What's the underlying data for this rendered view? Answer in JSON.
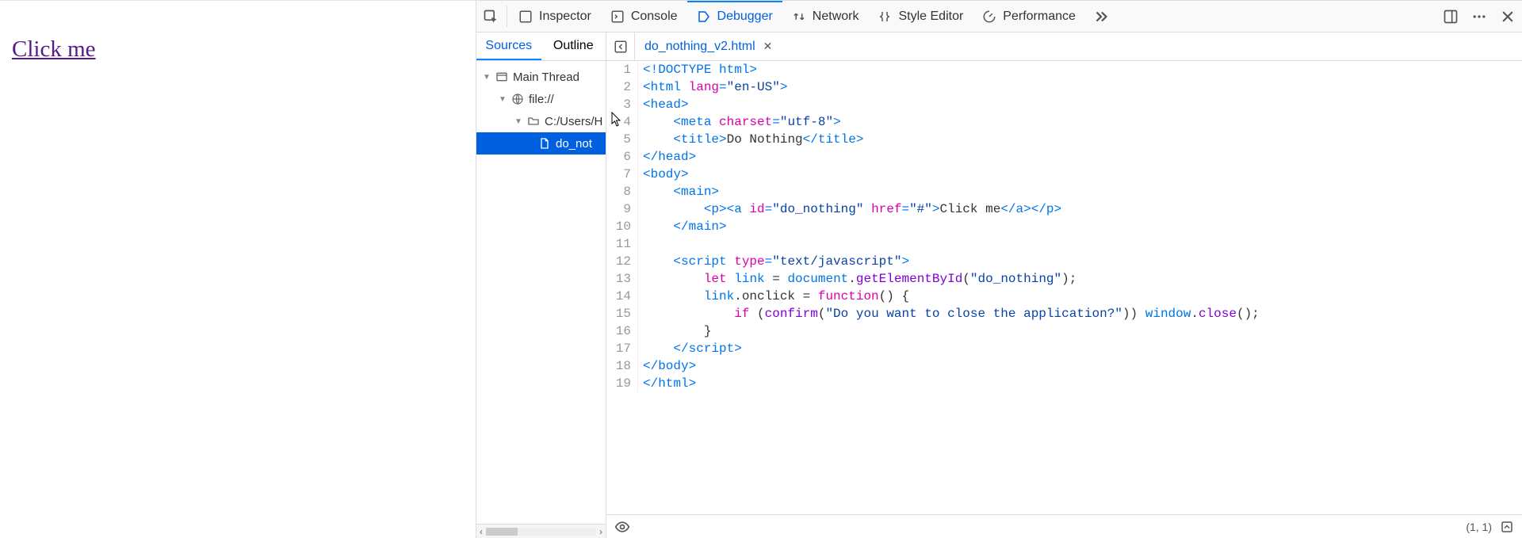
{
  "page": {
    "link_text": "Click me"
  },
  "devtools": {
    "tabs": {
      "inspector": "Inspector",
      "console": "Console",
      "debugger": "Debugger",
      "network": "Network",
      "style_editor": "Style Editor",
      "performance": "Performance"
    },
    "subtabs": {
      "sources": "Sources",
      "outline": "Outline"
    },
    "open_file": "do_nothing_v2.html",
    "tree": {
      "root": "Main Thread",
      "scheme": "file://",
      "folder": "C:/Users/H",
      "file": "do_not"
    },
    "cursor_pos": "(1, 1)",
    "code": {
      "lines": [
        [
          {
            "t": "doctype",
            "v": "<!DOCTYPE html>"
          }
        ],
        [
          {
            "t": "tag",
            "v": "<html "
          },
          {
            "t": "attr",
            "v": "lang"
          },
          {
            "t": "tag",
            "v": "="
          },
          {
            "t": "str",
            "v": "\"en-US\""
          },
          {
            "t": "tag",
            "v": ">"
          }
        ],
        [
          {
            "t": "tag",
            "v": "<head>"
          }
        ],
        [
          {
            "t": "text",
            "v": "    "
          },
          {
            "t": "tag",
            "v": "<meta "
          },
          {
            "t": "attr",
            "v": "charset"
          },
          {
            "t": "tag",
            "v": "="
          },
          {
            "t": "str",
            "v": "\"utf-8\""
          },
          {
            "t": "tag",
            "v": ">"
          }
        ],
        [
          {
            "t": "text",
            "v": "    "
          },
          {
            "t": "tag",
            "v": "<title>"
          },
          {
            "t": "text",
            "v": "Do Nothing"
          },
          {
            "t": "tag",
            "v": "</title>"
          }
        ],
        [
          {
            "t": "tag",
            "v": "</head>"
          }
        ],
        [
          {
            "t": "tag",
            "v": "<body>"
          }
        ],
        [
          {
            "t": "text",
            "v": "    "
          },
          {
            "t": "tag",
            "v": "<main>"
          }
        ],
        [
          {
            "t": "text",
            "v": "        "
          },
          {
            "t": "tag",
            "v": "<p><a "
          },
          {
            "t": "attr",
            "v": "id"
          },
          {
            "t": "tag",
            "v": "="
          },
          {
            "t": "str",
            "v": "\"do_nothing\""
          },
          {
            "t": "tag",
            "v": " "
          },
          {
            "t": "attr",
            "v": "href"
          },
          {
            "t": "tag",
            "v": "="
          },
          {
            "t": "str",
            "v": "\"#\""
          },
          {
            "t": "tag",
            "v": ">"
          },
          {
            "t": "text",
            "v": "Click me"
          },
          {
            "t": "tag",
            "v": "</a></p>"
          }
        ],
        [
          {
            "t": "text",
            "v": "    "
          },
          {
            "t": "tag",
            "v": "</main>"
          }
        ],
        [
          {
            "t": "text",
            "v": ""
          }
        ],
        [
          {
            "t": "text",
            "v": "    "
          },
          {
            "t": "tag",
            "v": "<script "
          },
          {
            "t": "attr",
            "v": "type"
          },
          {
            "t": "tag",
            "v": "="
          },
          {
            "t": "str",
            "v": "\"text/javascript\""
          },
          {
            "t": "tag",
            "v": ">"
          }
        ],
        [
          {
            "t": "text",
            "v": "        "
          },
          {
            "t": "kw",
            "v": "let"
          },
          {
            "t": "text",
            "v": " "
          },
          {
            "t": "var",
            "v": "link"
          },
          {
            "t": "text",
            "v": " = "
          },
          {
            "t": "var",
            "v": "document"
          },
          {
            "t": "text",
            "v": "."
          },
          {
            "t": "fn",
            "v": "getElementById"
          },
          {
            "t": "text",
            "v": "("
          },
          {
            "t": "str",
            "v": "\"do_nothing\""
          },
          {
            "t": "text",
            "v": ");"
          }
        ],
        [
          {
            "t": "text",
            "v": "        "
          },
          {
            "t": "var",
            "v": "link"
          },
          {
            "t": "text",
            "v": ".onclick = "
          },
          {
            "t": "kw",
            "v": "function"
          },
          {
            "t": "text",
            "v": "() {"
          }
        ],
        [
          {
            "t": "text",
            "v": "            "
          },
          {
            "t": "kw",
            "v": "if"
          },
          {
            "t": "text",
            "v": " ("
          },
          {
            "t": "fn",
            "v": "confirm"
          },
          {
            "t": "text",
            "v": "("
          },
          {
            "t": "str",
            "v": "\"Do you want to close the application?\""
          },
          {
            "t": "text",
            "v": ")) "
          },
          {
            "t": "var",
            "v": "window"
          },
          {
            "t": "text",
            "v": "."
          },
          {
            "t": "fn",
            "v": "close"
          },
          {
            "t": "text",
            "v": "();"
          }
        ],
        [
          {
            "t": "text",
            "v": "        }"
          }
        ],
        [
          {
            "t": "text",
            "v": "    "
          },
          {
            "t": "tag",
            "v": "</script>"
          }
        ],
        [
          {
            "t": "tag",
            "v": "</body>"
          }
        ],
        [
          {
            "t": "tag",
            "v": "</html>"
          }
        ]
      ]
    }
  }
}
